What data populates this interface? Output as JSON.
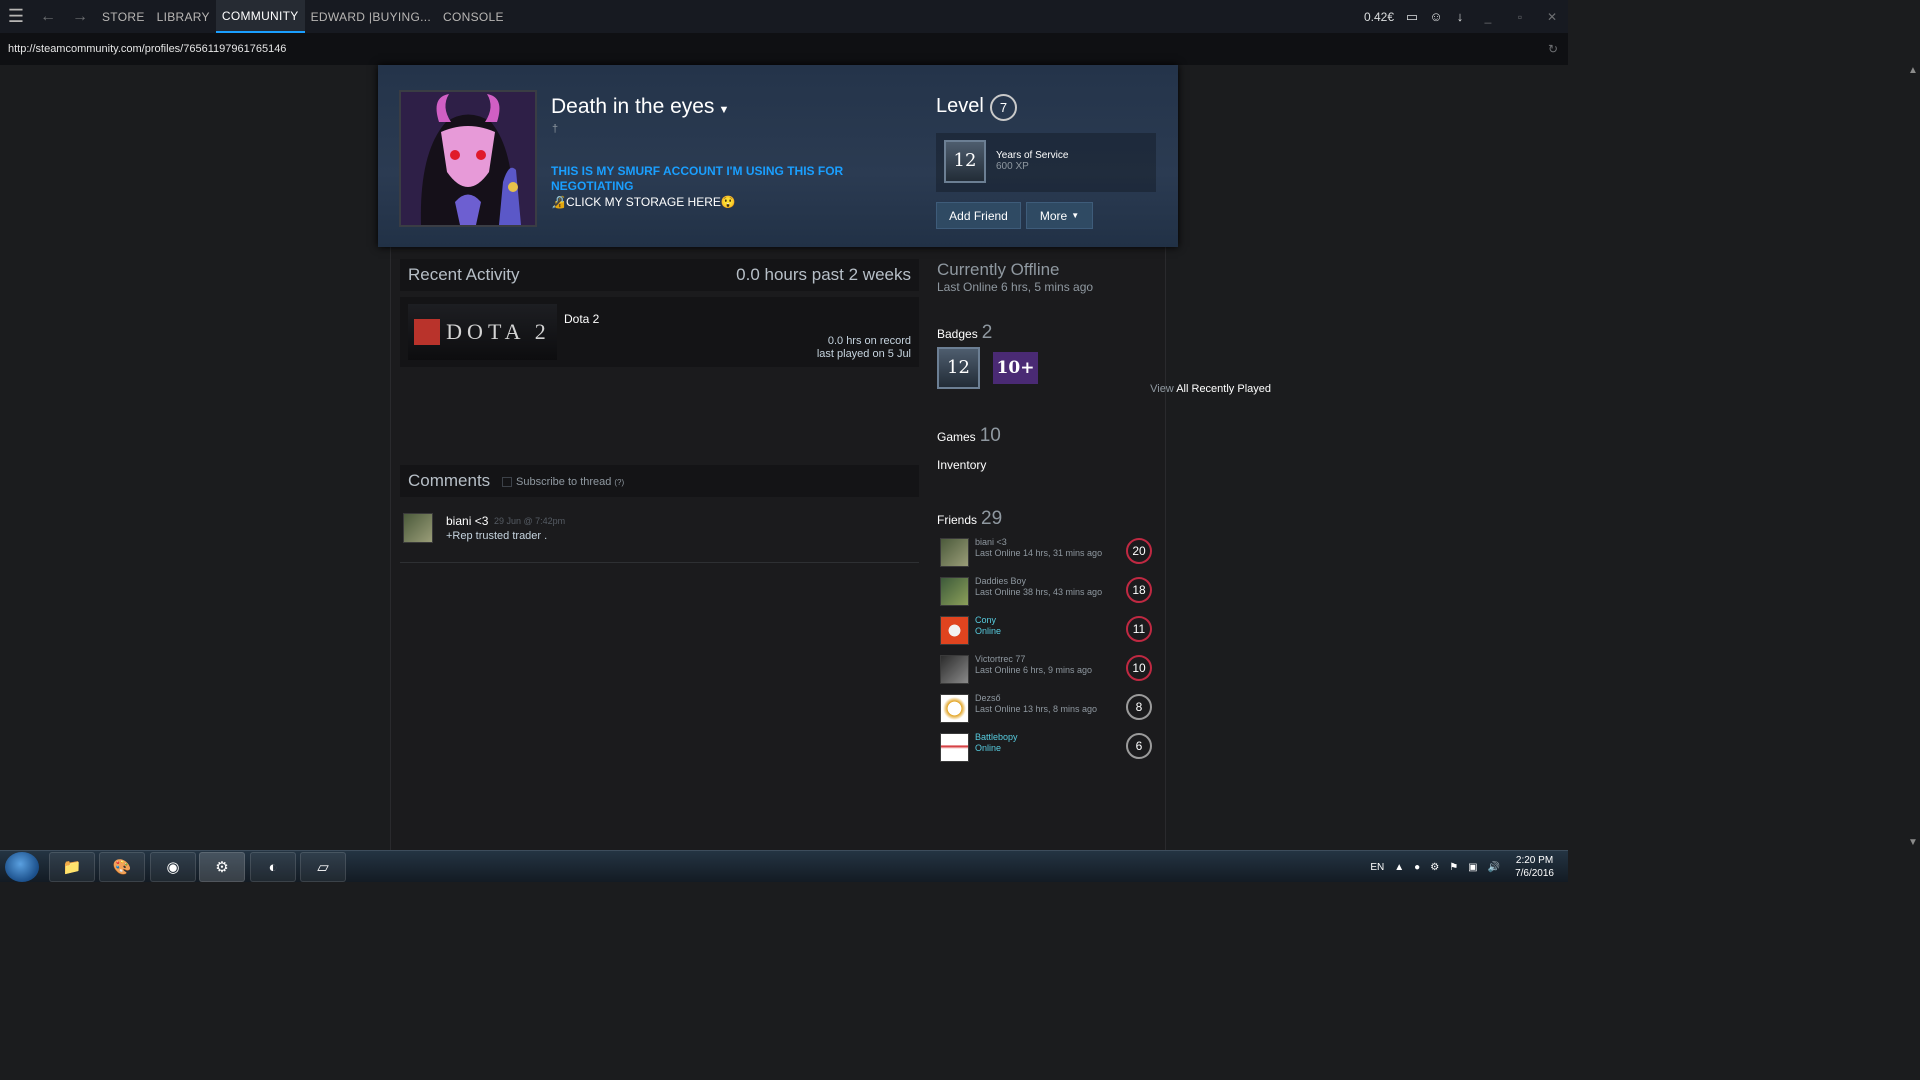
{
  "topbar": {
    "nav": [
      "STORE",
      "LIBRARY",
      "COMMUNITY",
      "EDWARD |BUYING...",
      "CONSOLE"
    ],
    "active": "COMMUNITY",
    "wallet": "0.42€"
  },
  "url": "http://steamcommunity.com/profiles/76561197961765146",
  "profile": {
    "persona_name": "Death in the eyes",
    "real_name": "†",
    "summary_line1": "THIS IS MY SMURF ACCOUNT I'M USING THIS FOR NEGOTIATING",
    "summary_line2": "🔏CLICK MY STORAGE HERE😲",
    "level_label": "Level",
    "level": "7",
    "favorite_badge": {
      "name": "Years of Service",
      "xp": "600 XP",
      "icon_text": "12"
    },
    "add_friend": "Add Friend",
    "more": "More"
  },
  "recent_activity": {
    "title": "Recent Activity",
    "hours_summary": "0.0 hours past 2 weeks",
    "game": {
      "name": "Dota 2",
      "capsule_text": "DOTA 2",
      "hrs_on_record": "0.0 hrs on record",
      "last_played": "last played on 5 Jul"
    },
    "view_all_prefix": "View",
    "view_all_link": "All Recently Played"
  },
  "comments": {
    "title": "Comments",
    "subscribe": "Subscribe to thread",
    "subscribe_count": "(?)",
    "items": [
      {
        "author": "biani <3",
        "date": "29 Jun @ 7:42pm",
        "text": "+Rep trusted trader ."
      }
    ]
  },
  "sidebar": {
    "status": "Currently Offline",
    "last_online": "Last Online 6 hrs, 5 mins ago",
    "badges_label": "Badges",
    "badges_count": "2",
    "badge_icons": [
      "12",
      "10+"
    ],
    "games_label": "Games",
    "games_count": "10",
    "inventory": "Inventory",
    "friends_label": "Friends",
    "friends_count": "29",
    "friends": [
      {
        "name": "biani <3",
        "status": "Last Online 14 hrs, 31 mins ago",
        "level": "20",
        "online": false
      },
      {
        "name": "Daddies Boy",
        "status": "Last Online 38 hrs, 43 mins ago",
        "level": "18",
        "online": false
      },
      {
        "name": "Cony",
        "status": "Online",
        "level": "11",
        "online": true
      },
      {
        "name": "Victortrec 77",
        "status": "Last Online 6 hrs, 9 mins ago",
        "level": "10",
        "online": false
      },
      {
        "name": "Dezső",
        "status": "Last Online 13 hrs, 8 mins ago",
        "level": "8",
        "online": false
      },
      {
        "name": "Battlebopy",
        "status": "Online",
        "level": "6",
        "online": true
      }
    ]
  },
  "taskbar": {
    "lang": "EN",
    "time": "2:20 PM",
    "date": "7/6/2016"
  },
  "colors": {
    "accent_blue": "#1a9fff",
    "online_blue": "#57cbde",
    "level_red": "#c02942"
  }
}
